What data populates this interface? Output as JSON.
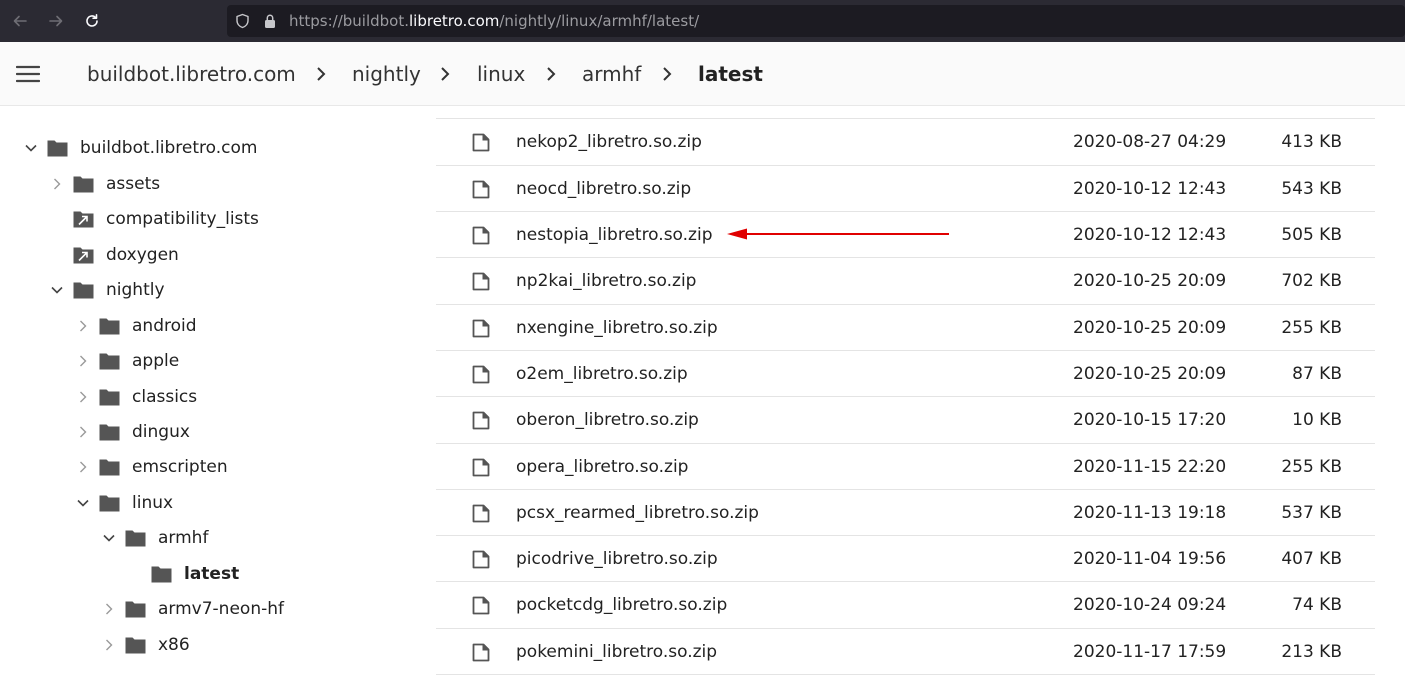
{
  "browser": {
    "url_prefix": "https://buildbot.",
    "url_domain": "libretro.com",
    "url_path": "/nightly/linux/armhf/latest/"
  },
  "breadcrumb": {
    "items": [
      "buildbot.libretro.com",
      "nightly",
      "linux",
      "armhf",
      "latest"
    ]
  },
  "tree": [
    {
      "label": "buildbot.libretro.com",
      "state": "expanded",
      "icon": "folder-icon"
    },
    {
      "label": "assets",
      "state": "collapsed",
      "icon": "folder-icon"
    },
    {
      "label": "compatibility_lists",
      "state": "none",
      "icon": "folder-link-icon"
    },
    {
      "label": "doxygen",
      "state": "none",
      "icon": "folder-link-icon"
    },
    {
      "label": "nightly",
      "state": "expanded",
      "icon": "folder-icon"
    },
    {
      "label": "android",
      "state": "collapsed",
      "icon": "folder-icon"
    },
    {
      "label": "apple",
      "state": "collapsed",
      "icon": "folder-icon"
    },
    {
      "label": "classics",
      "state": "collapsed",
      "icon": "folder-icon"
    },
    {
      "label": "dingux",
      "state": "collapsed",
      "icon": "folder-icon"
    },
    {
      "label": "emscripten",
      "state": "collapsed",
      "icon": "folder-icon"
    },
    {
      "label": "linux",
      "state": "expanded",
      "icon": "folder-icon"
    },
    {
      "label": "armhf",
      "state": "expanded",
      "icon": "folder-icon"
    },
    {
      "label": "latest",
      "state": "none",
      "icon": "folder-icon"
    },
    {
      "label": "armv7-neon-hf",
      "state": "collapsed",
      "icon": "folder-icon"
    },
    {
      "label": "x86",
      "state": "collapsed",
      "icon": "folder-icon"
    }
  ],
  "files": [
    {
      "name": "nekop2_libretro.so.zip",
      "date": "2020-08-27 04:29",
      "size": "413 KB"
    },
    {
      "name": "neocd_libretro.so.zip",
      "date": "2020-10-12 12:43",
      "size": "543 KB"
    },
    {
      "name": "nestopia_libretro.so.zip",
      "date": "2020-10-12 12:43",
      "size": "505 KB"
    },
    {
      "name": "np2kai_libretro.so.zip",
      "date": "2020-10-25 20:09",
      "size": "702 KB"
    },
    {
      "name": "nxengine_libretro.so.zip",
      "date": "2020-10-25 20:09",
      "size": "255 KB"
    },
    {
      "name": "o2em_libretro.so.zip",
      "date": "2020-10-25 20:09",
      "size": "87 KB"
    },
    {
      "name": "oberon_libretro.so.zip",
      "date": "2020-10-15 17:20",
      "size": "10 KB"
    },
    {
      "name": "opera_libretro.so.zip",
      "date": "2020-11-15 22:20",
      "size": "255 KB"
    },
    {
      "name": "pcsx_rearmed_libretro.so.zip",
      "date": "2020-11-13 19:18",
      "size": "537 KB"
    },
    {
      "name": "picodrive_libretro.so.zip",
      "date": "2020-11-04 19:56",
      "size": "407 KB"
    },
    {
      "name": "pocketcdg_libretro.so.zip",
      "date": "2020-10-24 09:24",
      "size": "74 KB"
    },
    {
      "name": "pokemini_libretro.so.zip",
      "date": "2020-11-17 17:59",
      "size": "213 KB"
    }
  ],
  "colors": {
    "toolbar": "#2b2a33",
    "urlbar": "#1c1b22",
    "icon_gray": "#555555",
    "annotation_arrow": "#e00000"
  }
}
